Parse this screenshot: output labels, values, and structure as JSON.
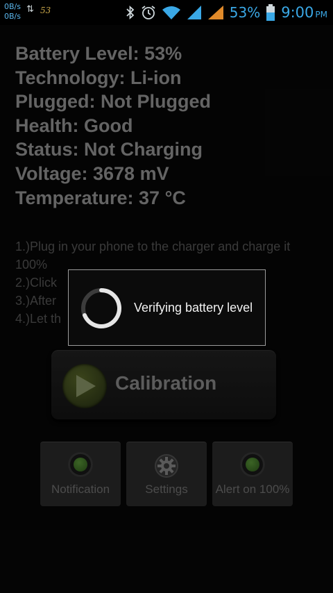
{
  "status_bar": {
    "net_up": "0B/s",
    "net_down": "0B/s",
    "app_badge": "53",
    "battery_percent": "53%",
    "time": "9:00",
    "ampm": "PM",
    "icons": [
      "bluetooth-icon",
      "alarm-icon",
      "wifi-icon",
      "signal-icon",
      "signal-icon",
      "battery-icon"
    ]
  },
  "battery_info": [
    "Battery Level: 53%",
    "Technology: Li-ion",
    "Plugged: Not Plugged",
    "Health: Good",
    "Status: Not Charging",
    "Voltage: 3678 mV",
    "Temperature: 37 °C"
  ],
  "instructions": [
    "1.)Plug in your phone to the charger and charge it 100%",
    "2.)Click",
    "3.)After",
    "4.)Let th"
  ],
  "calibration_button": {
    "label": "Calibration",
    "icon": "play-icon"
  },
  "bottom_buttons": [
    {
      "label": "Notification",
      "icon": "led-icon"
    },
    {
      "label": "Settings",
      "icon": "gear-icon"
    },
    {
      "label": "Alert on 100%",
      "icon": "led-icon"
    }
  ],
  "dialog": {
    "message": "Verifying battery level"
  },
  "colors": {
    "status_accent": "#3aa8e6",
    "background": "#050505",
    "led_green": "#5c9a3a"
  }
}
